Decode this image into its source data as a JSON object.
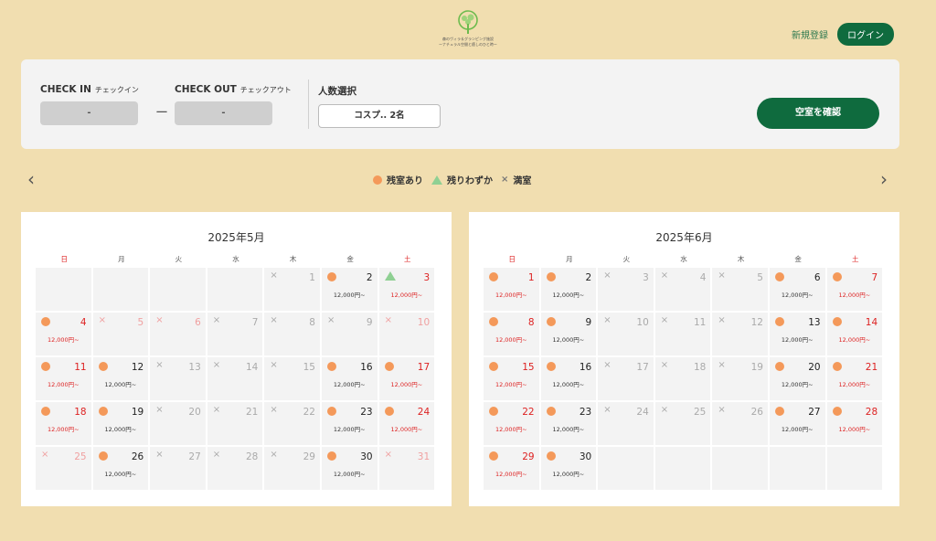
{
  "header": {
    "logo_text": "森のヴィラ＆グランピング施設",
    "logo_subtext": "ーナチュラル空間と癒しのひと時ー",
    "register_label": "新規登録",
    "login_label": "ログイン"
  },
  "search": {
    "checkin_label": "CHECK IN",
    "checkin_sub": "チェックイン",
    "checkin_value": "-",
    "separator": "ー",
    "checkout_label": "CHECK OUT",
    "checkout_sub": "チェックアウト",
    "checkout_value": "-",
    "guests_label": "人数選択",
    "guests_value": "コスプ.. 2名",
    "submit_label": "空室を確認"
  },
  "nav": {
    "prev": "‹",
    "next": "›"
  },
  "legend": {
    "available": "残室あり",
    "few_left": "残りわずか",
    "full_mark": "×",
    "full": "満室"
  },
  "colors": {
    "accent": "#0f6b3e",
    "available": "#f4995a",
    "few_left": "#8fd093",
    "holiday": "#dd2222",
    "background": "#f1deb0"
  },
  "calendars": [
    {
      "title": "2025年5月",
      "weekdays": [
        "日",
        "月",
        "火",
        "水",
        "木",
        "金",
        "土"
      ],
      "leading_blanks": 4,
      "days": [
        {
          "d": "1",
          "s": "full"
        },
        {
          "d": "2",
          "s": "avail",
          "p": "12,000円~"
        },
        {
          "d": "3",
          "s": "few",
          "p": "12,000円~",
          "red": true
        },
        {
          "d": "4",
          "s": "avail",
          "p": "12,000円~",
          "red": true
        },
        {
          "d": "5",
          "s": "full",
          "red": true
        },
        {
          "d": "6",
          "s": "full",
          "red": true
        },
        {
          "d": "7",
          "s": "full"
        },
        {
          "d": "8",
          "s": "full"
        },
        {
          "d": "9",
          "s": "full"
        },
        {
          "d": "10",
          "s": "full",
          "red": true
        },
        {
          "d": "11",
          "s": "avail",
          "p": "12,000円~",
          "red": true
        },
        {
          "d": "12",
          "s": "avail",
          "p": "12,000円~"
        },
        {
          "d": "13",
          "s": "full"
        },
        {
          "d": "14",
          "s": "full"
        },
        {
          "d": "15",
          "s": "full"
        },
        {
          "d": "16",
          "s": "avail",
          "p": "12,000円~"
        },
        {
          "d": "17",
          "s": "avail",
          "p": "12,000円~",
          "red": true
        },
        {
          "d": "18",
          "s": "avail",
          "p": "12,000円~",
          "red": true
        },
        {
          "d": "19",
          "s": "avail",
          "p": "12,000円~"
        },
        {
          "d": "20",
          "s": "full"
        },
        {
          "d": "21",
          "s": "full"
        },
        {
          "d": "22",
          "s": "full"
        },
        {
          "d": "23",
          "s": "avail",
          "p": "12,000円~"
        },
        {
          "d": "24",
          "s": "avail",
          "p": "12,000円~",
          "red": true
        },
        {
          "d": "25",
          "s": "full",
          "red": true
        },
        {
          "d": "26",
          "s": "avail",
          "p": "12,000円~"
        },
        {
          "d": "27",
          "s": "full"
        },
        {
          "d": "28",
          "s": "full"
        },
        {
          "d": "29",
          "s": "full"
        },
        {
          "d": "30",
          "s": "avail",
          "p": "12,000円~"
        },
        {
          "d": "31",
          "s": "full",
          "red": true
        }
      ],
      "trailing_blanks": 0
    },
    {
      "title": "2025年6月",
      "weekdays": [
        "日",
        "月",
        "火",
        "水",
        "木",
        "金",
        "土"
      ],
      "leading_blanks": 0,
      "days": [
        {
          "d": "1",
          "s": "avail",
          "p": "12,000円~",
          "red": true
        },
        {
          "d": "2",
          "s": "avail",
          "p": "12,000円~"
        },
        {
          "d": "3",
          "s": "full"
        },
        {
          "d": "4",
          "s": "full"
        },
        {
          "d": "5",
          "s": "full"
        },
        {
          "d": "6",
          "s": "avail",
          "p": "12,000円~"
        },
        {
          "d": "7",
          "s": "avail",
          "p": "12,000円~",
          "red": true
        },
        {
          "d": "8",
          "s": "avail",
          "p": "12,000円~",
          "red": true
        },
        {
          "d": "9",
          "s": "avail",
          "p": "12,000円~"
        },
        {
          "d": "10",
          "s": "full"
        },
        {
          "d": "11",
          "s": "full"
        },
        {
          "d": "12",
          "s": "full"
        },
        {
          "d": "13",
          "s": "avail",
          "p": "12,000円~"
        },
        {
          "d": "14",
          "s": "avail",
          "p": "12,000円~",
          "red": true
        },
        {
          "d": "15",
          "s": "avail",
          "p": "12,000円~",
          "red": true
        },
        {
          "d": "16",
          "s": "avail",
          "p": "12,000円~"
        },
        {
          "d": "17",
          "s": "full"
        },
        {
          "d": "18",
          "s": "full"
        },
        {
          "d": "19",
          "s": "full"
        },
        {
          "d": "20",
          "s": "avail",
          "p": "12,000円~"
        },
        {
          "d": "21",
          "s": "avail",
          "p": "12,000円~",
          "red": true
        },
        {
          "d": "22",
          "s": "avail",
          "p": "12,000円~",
          "red": true
        },
        {
          "d": "23",
          "s": "avail",
          "p": "12,000円~"
        },
        {
          "d": "24",
          "s": "full"
        },
        {
          "d": "25",
          "s": "full"
        },
        {
          "d": "26",
          "s": "full"
        },
        {
          "d": "27",
          "s": "avail",
          "p": "12,000円~"
        },
        {
          "d": "28",
          "s": "avail",
          "p": "12,000円~",
          "red": true
        },
        {
          "d": "29",
          "s": "avail",
          "p": "12,000円~",
          "red": true
        },
        {
          "d": "30",
          "s": "avail",
          "p": "12,000円~"
        }
      ],
      "trailing_blanks": 5
    }
  ]
}
